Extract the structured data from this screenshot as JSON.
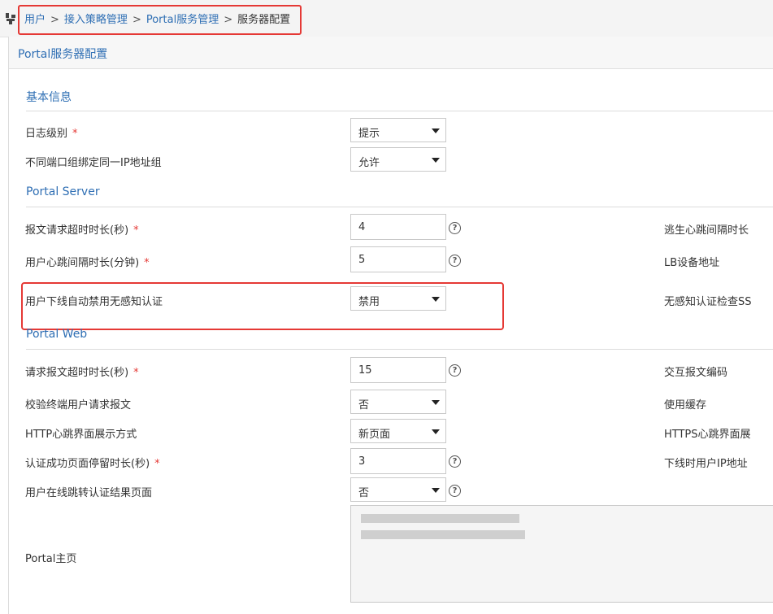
{
  "breadcrumb": {
    "items": [
      "用户",
      "接入策略管理",
      "Portal服务管理"
    ],
    "current": "服务器配置",
    "separator": ">"
  },
  "icons": {
    "breadcrumb": "plug-icon",
    "help": "question-circle-icon",
    "dropdown": "caret-down-icon"
  },
  "panel": {
    "title": "Portal服务器配置"
  },
  "sections": {
    "basic": "基本信息",
    "server": "Portal Server",
    "web": "Portal Web"
  },
  "required_mark": "*",
  "help_glyph": "?",
  "fields": {
    "log_level": {
      "label": "日志级别",
      "value": "提示",
      "required": true
    },
    "bind_ip_group": {
      "label": "不同端口组绑定同一IP地址组",
      "value": "允许"
    },
    "req_timeout_server": {
      "label": "报文请求超时时长(秒)",
      "value": "4",
      "required": true
    },
    "heartbeat_interval": {
      "label": "用户心跳间隔时长(分钟)",
      "value": "5",
      "required": true
    },
    "auto_disable_mac": {
      "label": "用户下线自动禁用无感知认证",
      "value": "禁用"
    },
    "req_timeout_web": {
      "label": "请求报文超时时长(秒)",
      "value": "15",
      "required": true
    },
    "verify_terminal": {
      "label": "校验终端用户请求报文",
      "value": "否"
    },
    "http_heartbeat_mode": {
      "label": "HTTP心跳界面展示方式",
      "value": "新页面"
    },
    "success_stay": {
      "label": "认证成功页面停留时长(秒)",
      "value": "3",
      "required": true
    },
    "online_redirect": {
      "label": "用户在线跳转认证结果页面",
      "value": "否"
    },
    "portal_home": {
      "label": "Portal主页"
    }
  },
  "right_labels": {
    "escape_heartbeat": "逃生心跳间隔时长",
    "lb_address": "LB设备地址",
    "mac_ssl_check": "无感知认证检查SS",
    "encoding": "交互报文编码",
    "cache": "使用缓存",
    "https_heartbeat": "HTTPS心跳界面展",
    "offline_ip": "下线时用户IP地址"
  },
  "colors": {
    "link": "#2f6fb4",
    "required": "#e53935",
    "highlight": "#e53935"
  }
}
